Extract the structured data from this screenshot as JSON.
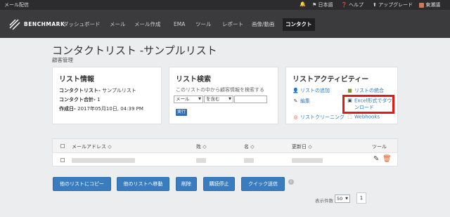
{
  "topbar": {
    "app_title": "メール配信",
    "language": "日本語",
    "help": "ヘルプ",
    "upgrade": "アップグレード",
    "user": "東瀬議"
  },
  "nav": {
    "logo_text": "BENCHMARK",
    "items": [
      "ダッシュボード",
      "メール",
      "メール作成",
      "EMA",
      "ツール",
      "レポート",
      "画像/動画",
      "コンタクト"
    ],
    "active": "コンタクト"
  },
  "page": {
    "title": "コンタクトリスト -サンプルリスト",
    "subtitle": "顧客管理"
  },
  "list_info": {
    "heading": "リスト情報",
    "name_label": "コンタクトリスト-",
    "name_value": "サンプルリスト",
    "total_label": "コンタクト合計-",
    "total_value": "1",
    "created_label": "作成日-",
    "created_value": "2017年05月10日, 04:39 PM"
  },
  "search": {
    "heading": "リスト検索",
    "description": "このリストの中から顧客情報を検索する",
    "field_select": "メール",
    "operator_select": "を含む",
    "run_button": "実行"
  },
  "activity": {
    "heading": "リストアクティビティー",
    "add": "リストの追加",
    "merge": "リストの統合",
    "edit": "編集",
    "excel_download_line1": "Excel形式でダウ",
    "excel_download_line2": "ンロード",
    "cleaning": "リストクリーニング",
    "webhooks": "Webhooks"
  },
  "table": {
    "col_email": "メールアドレス ◇",
    "col_last": "姓 ◇",
    "col_first": "名 ◇",
    "col_updated": "更新日 ◇",
    "col_tools": "ツール"
  },
  "actions": {
    "copy": "他のリストにコピー",
    "move": "他のリストへ移動",
    "delete": "削除",
    "unsubscribe": "購読停止",
    "quick_send": "クイック送信"
  },
  "pagination": {
    "per_page_label": "表示件数",
    "per_page_value": "50",
    "page": "1"
  },
  "colors": {
    "accent": "#3a7cc0",
    "highlight": "#e0191b",
    "nav_bg": "#3b3b3d"
  }
}
